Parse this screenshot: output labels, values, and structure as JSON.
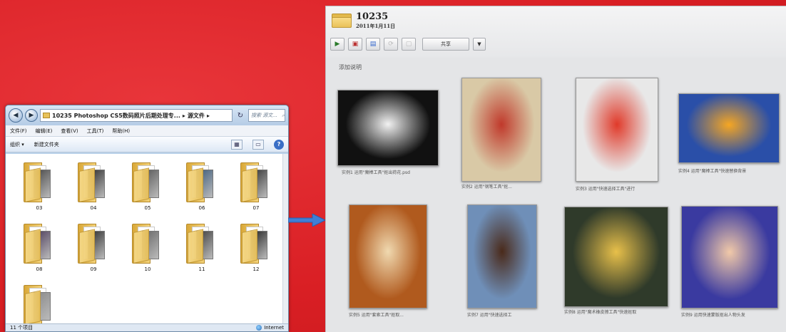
{
  "explorer": {
    "address_path": "10235 Photoshop CS5数码照片后期处理专...",
    "address_sub": "源文件",
    "search_placeholder": "搜索 源文...",
    "menu": [
      "文件(F)",
      "编辑(E)",
      "查看(V)",
      "工具(T)",
      "帮助(H)"
    ],
    "toolbar": {
      "organize": "组织 ▾",
      "new_folder": "新建文件夹"
    },
    "folders": [
      "03",
      "04",
      "05",
      "06",
      "07",
      "08",
      "09",
      "10",
      "11",
      "12",
      ""
    ],
    "status_count": "11 个项目",
    "status_zone": "Internet"
  },
  "gallery": {
    "title": "10235",
    "date": "2011年1月11日",
    "share_label": "共享",
    "add_caption": "添加说明",
    "photos": [
      {
        "caption": "实例1 运用\"魔棒工具\"抠出荷花.psd",
        "color": "#111111",
        "accent": "#f2f2f2"
      },
      {
        "caption": "实例2 运用\"钢笔工具\"抠...",
        "color": "#d9c9a6",
        "accent": "#c0392b"
      },
      {
        "caption": "实例3 运用\"快速选择工具\"进行",
        "color": "#e8e8e8",
        "accent": "#e03a2a"
      },
      {
        "caption": "实例4 运用\"魔棒工具\"快速替换背景",
        "color": "#2a4fa8",
        "accent": "#f5a623"
      },
      {
        "caption": "实例5 运用\"套索工具\"抠取...",
        "color": "#b05a1e",
        "accent": "#f0d9b0"
      },
      {
        "caption": "实例7 运用\"快速选择工",
        "color": "#6f8fb8",
        "accent": "#4a2a1a"
      },
      {
        "caption": "实例8 运用\"魔术橡皮擦工具\"快速抠取",
        "color": "#2f3a2a",
        "accent": "#e8c04a"
      },
      {
        "caption": "实例9 运用快速蒙版抠出人物头发",
        "color": "#3a3aa0",
        "accent": "#f1c9a8"
      }
    ]
  }
}
